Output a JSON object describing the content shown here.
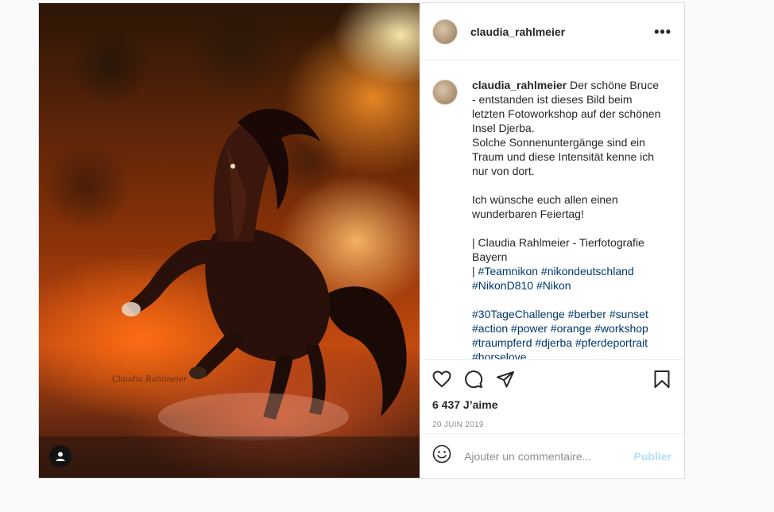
{
  "post": {
    "username": "claudia_rahlmeier",
    "more_icon": "more-horizontal-icon",
    "photo_watermark": "Claudia Rahlmeier",
    "caption": {
      "username": "claudia_rahlmeier",
      "text": " Der schöne Bruce - entstanden ist dieses Bild beim letzten Fotoworkshop auf der schönen Insel Djerba.\nSolche Sonnenuntergänge sind ein Traum und diese Intensität kenne ich nur von dort.\n\nIch wünsche euch allen einen wunderbaren Feiertag!\n\n| Claudia Rahlmeier - Tierfotografie Bayern\n| ",
      "hashtags_line1": [
        "#Teamnikon",
        "#nikondeutschland",
        "#NikonD810",
        "#Nikon"
      ],
      "hashtags_line2": [
        "#30TageChallenge",
        "#berber",
        "#sunset",
        "#action",
        "#power",
        "#orange",
        "#workshop",
        "#traumpferd",
        "#djerba",
        "#pferdeportrait",
        "#horselove"
      ]
    },
    "likes": "6 437 J’aime",
    "date": "20 JUIN 2019",
    "comment_placeholder": "Ajouter un commentaire...",
    "publish_label": "Publier"
  },
  "colors": {
    "link": "#00376b",
    "publish": "#b2dffc"
  }
}
